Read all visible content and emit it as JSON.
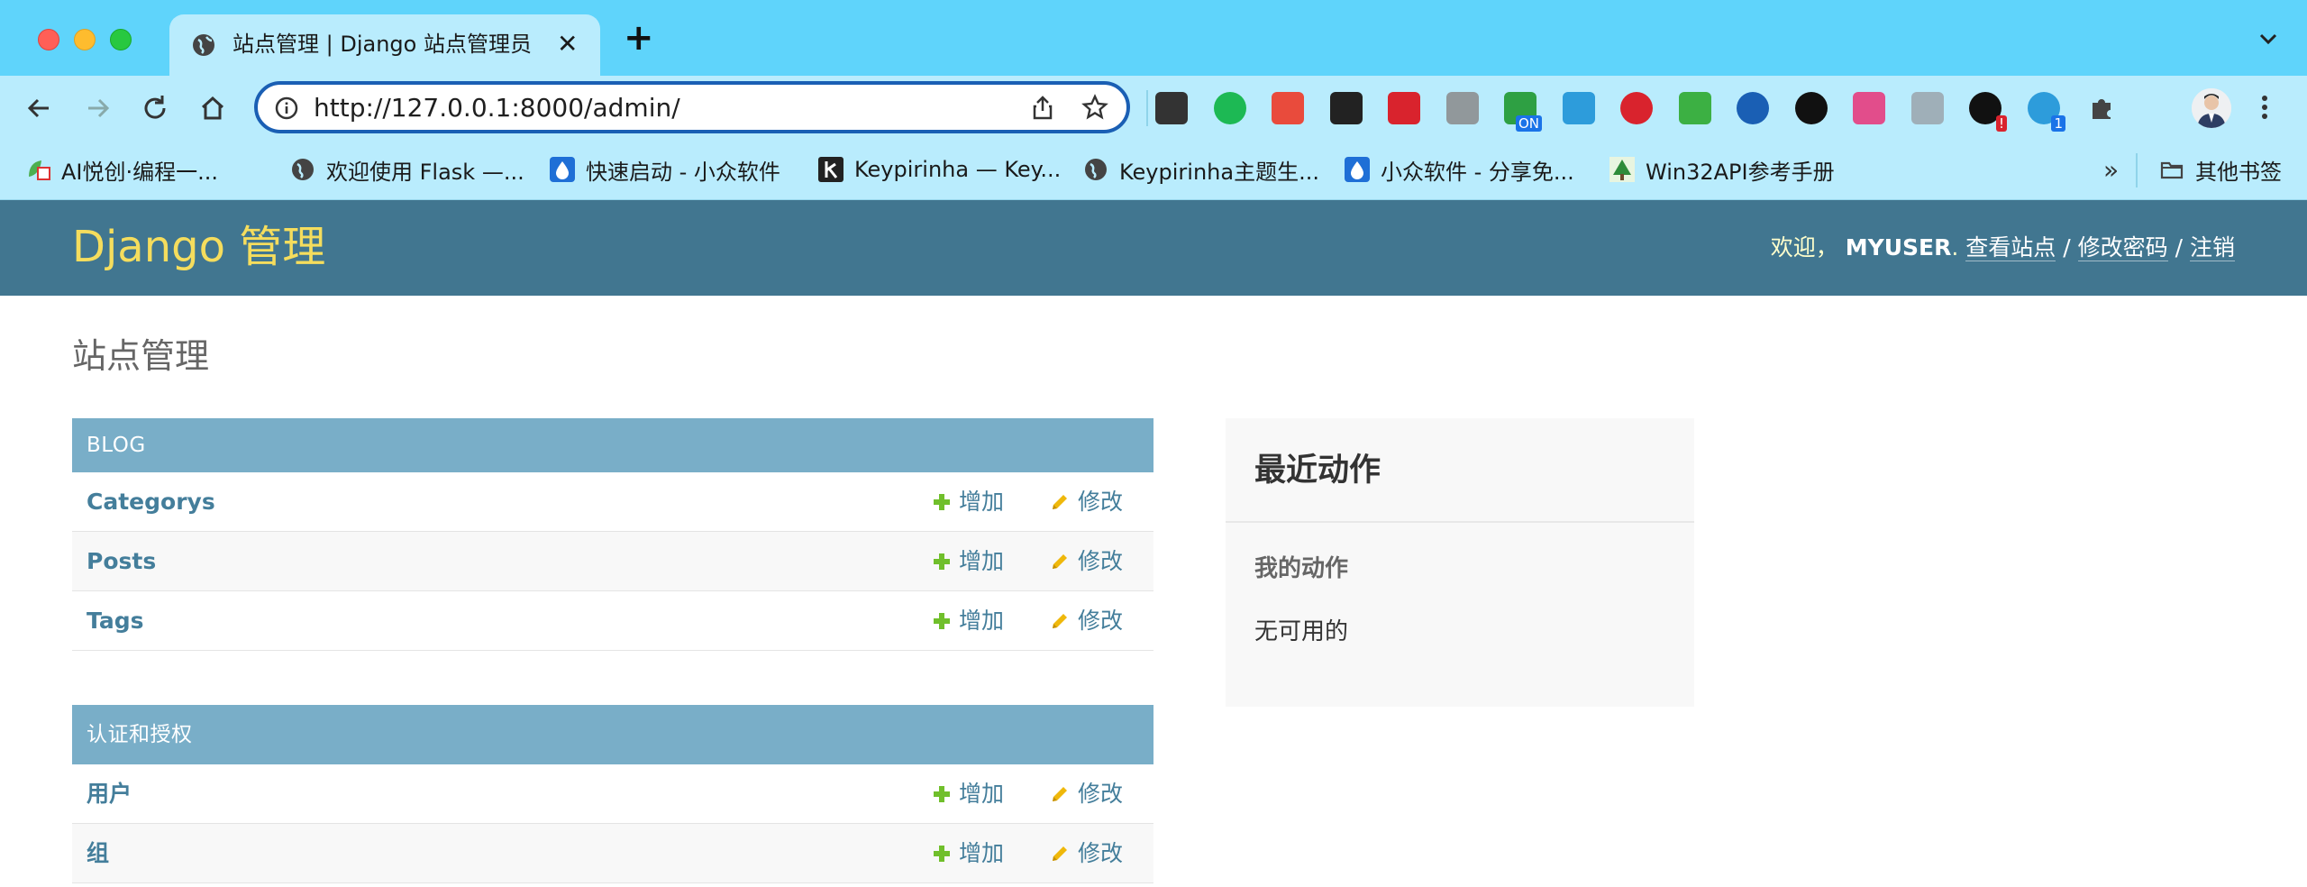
{
  "browser": {
    "tab_title": "站点管理 | Django 站点管理员",
    "tab_close": "✕",
    "new_tab": "+",
    "url": "http://127.0.0.1:8000/admin/",
    "extensions": [
      {
        "name": "x-icon",
        "color": "#333333"
      },
      {
        "name": "nuxt-icon",
        "color": "#1db954"
      },
      {
        "name": "grid-icon",
        "color": "#e94b3c"
      },
      {
        "name": "tampermonkey-icon",
        "color": "#222222"
      },
      {
        "name": "fe-icon",
        "color": "#d9232d"
      },
      {
        "name": "camera-icon",
        "color": "#8a8a8a"
      },
      {
        "name": "info-on-icon",
        "color": "#2ea043"
      },
      {
        "name": "cat-icon",
        "color": "#2d9cdb"
      },
      {
        "name": "adblock-icon",
        "color": "#d9232d"
      },
      {
        "name": "shield-check-icon",
        "color": "#3cb043"
      },
      {
        "name": "triangle-icon",
        "color": "#1a5fb4"
      },
      {
        "name": "github-icon",
        "color": "#111111"
      },
      {
        "name": "pinwheel-icon",
        "color": "#e24d8b"
      },
      {
        "name": "gitzip-icon",
        "color": "#9aa5ab"
      },
      {
        "name": "bird-icon",
        "color": "#111111"
      },
      {
        "name": "translate-icon",
        "color": "#2d9cdb"
      },
      {
        "name": "puzzle-icon",
        "color": "#444444"
      }
    ],
    "extension_badges": {
      "info_on": "ON",
      "bird": "!",
      "translate": "1"
    },
    "bookmarks": [
      {
        "label": "AI悦创·编程一...",
        "icon": "leaf-calendar-icon"
      },
      {
        "label": "欢迎使用 Flask —...",
        "icon": "globe-icon"
      },
      {
        "label": "快速启动 - 小众软件",
        "icon": "drop-icon"
      },
      {
        "label": "Keypirinha — Key...",
        "icon": "k-icon"
      },
      {
        "label": "Keypirinha主题生...",
        "icon": "globe-icon"
      },
      {
        "label": "小众软件 - 分享免...",
        "icon": "drop-icon"
      },
      {
        "label": "Win32API参考手册",
        "icon": "tree-icon"
      }
    ],
    "bookmarks_more": "»",
    "other_bookmarks": "其他书签"
  },
  "header": {
    "brand": "Django 管理",
    "welcome": "欢迎，",
    "username": "MYUSER",
    "period": ".",
    "view_site": "查看站点",
    "sep": "/",
    "change_password": "修改密码",
    "logout": "注销"
  },
  "content": {
    "title": "站点管理",
    "add_label": "增加",
    "change_label": "修改",
    "apps": [
      {
        "name": "BLOG",
        "models": [
          "Categorys",
          "Posts",
          "Tags"
        ]
      },
      {
        "name": "认证和授权",
        "models": [
          "用户",
          "组"
        ]
      }
    ]
  },
  "recent_actions": {
    "title": "最近动作",
    "my_actions": "我的动作",
    "none": "无可用的"
  },
  "colors": {
    "header_bg": "#417690",
    "brand": "#f5dd5d",
    "caption_bg": "#79aec8",
    "link": "#447e9b",
    "add_green": "#70bf2b",
    "change_yellow": "#efb80b"
  }
}
